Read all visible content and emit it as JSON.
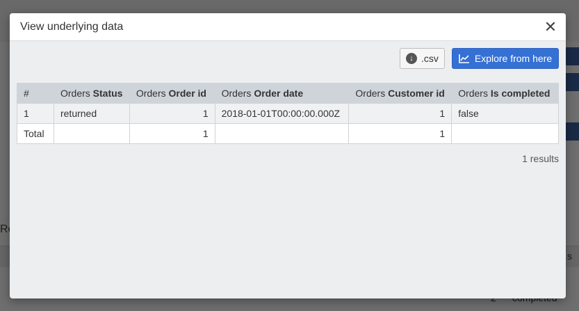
{
  "modal": {
    "title": "View underlying data",
    "close_glyph": "✕",
    "csv_label": ".csv",
    "explore_label": "Explore from here",
    "results_text": "1 results"
  },
  "table": {
    "headers": [
      {
        "prefix": "#",
        "bold": ""
      },
      {
        "prefix": "Orders ",
        "bold": "Status"
      },
      {
        "prefix": "Orders ",
        "bold": "Order id"
      },
      {
        "prefix": "Orders ",
        "bold": "Order date"
      },
      {
        "prefix": "Orders ",
        "bold": "Customer id"
      },
      {
        "prefix": "Orders ",
        "bold": "Is completed"
      }
    ],
    "rows": [
      [
        "1",
        "returned",
        "1",
        "2018-01-01T00:00:00.000Z",
        "1",
        "false"
      ]
    ],
    "total": [
      "Total",
      "",
      "1",
      "",
      "1",
      ""
    ]
  },
  "background": {
    "partial_label": "Re",
    "cell_number": "2",
    "cell_text": "completed",
    "corner_text": "s"
  },
  "colors": {
    "primary": "#3570d4",
    "header_bg": "#cfd4da"
  }
}
